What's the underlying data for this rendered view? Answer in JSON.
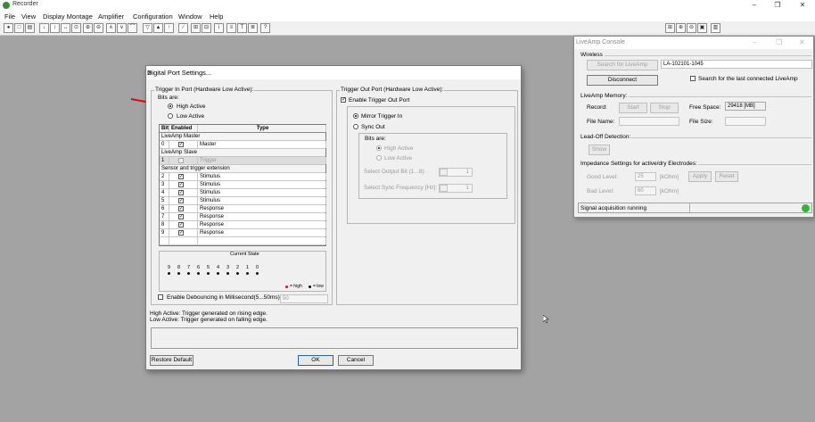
{
  "app": {
    "title": "Recorder"
  },
  "window_controls": {
    "minimize": "–",
    "maximize": "❐",
    "close": "✕"
  },
  "menu": [
    "File",
    "View",
    "Display Montage",
    "Amplifier",
    "Configuration",
    "Window",
    "Help"
  ],
  "toolbar": {
    "icons": [
      "●",
      "□",
      "▤",
      "↓",
      "↕",
      "↔",
      "⊙",
      "⊕",
      "⊖",
      "∧",
      "∨",
      "⌒",
      "▽",
      "▲",
      "↑",
      "∕",
      "⊞",
      "⊟",
      "i",
      "≡",
      "T",
      "≣",
      "?"
    ],
    "right_icons": [
      "⊞",
      "⊕",
      "⊖",
      "▣",
      "▥"
    ]
  },
  "dialog": {
    "title": "Digital Port Settings...",
    "close": "✕",
    "trigger_in": {
      "label": "Trigger In Port (Hardware Low Active):",
      "bits_are": "Bits are:",
      "high_active": "High Active",
      "low_active": "Low Active",
      "table": {
        "headers": [
          "Bit",
          "Enabled",
          "Type"
        ],
        "rows": [
          {
            "section": "LiveAmp Master"
          },
          {
            "bit": "0",
            "enabled": "✓",
            "type": "Master"
          },
          {
            "section": "LiveAmp Slave"
          },
          {
            "bit": "1",
            "enabled": "",
            "type": "Trigger"
          },
          {
            "section": "Sensor and trigger extension"
          },
          {
            "bit": "2",
            "enabled": "✓",
            "type": "Stimulus"
          },
          {
            "bit": "3",
            "enabled": "✓",
            "type": "Stimulus"
          },
          {
            "bit": "4",
            "enabled": "✓",
            "type": "Stimulus"
          },
          {
            "bit": "5",
            "enabled": "✓",
            "type": "Stimulus"
          },
          {
            "bit": "6",
            "enabled": "✓",
            "type": "Response"
          },
          {
            "bit": "7",
            "enabled": "✓",
            "type": "Response"
          },
          {
            "bit": "8",
            "enabled": "✓",
            "type": "Response"
          },
          {
            "bit": "9",
            "enabled": "✓",
            "type": "Response"
          },
          {
            "bit": "",
            "enabled": "",
            "type": ""
          }
        ]
      },
      "current_state": {
        "label": "Current State",
        "bits": [
          "9",
          "8",
          "7",
          "6",
          "5",
          "4",
          "3",
          "2",
          "1",
          "0"
        ],
        "legend_high": "= high",
        "legend_low": "= low"
      },
      "debounce_label": "Enable Debouncing in Millisecond(5...50ms):",
      "debounce_value": "50"
    },
    "trigger_out": {
      "label": "Trigger Out Port (Hardware Low Active):",
      "enable_label": "Enable Trigger Out Port",
      "mirror": "Mirror Trigger In",
      "sync_out": "Sync Out",
      "bits_are": "Bits are:",
      "high_active": "High Active",
      "low_active": "Low Active",
      "select_output_bit": "Select Output Bit (1...8):",
      "select_output_bit_value": "1",
      "select_sync_freq": "Select Sync Frequency [Hz]:",
      "select_sync_freq_value": "1"
    },
    "info_line1": "High Active: Trigger generated on rising edge.",
    "info_line2": "Low Active: Trigger generated on falling edge.",
    "restore_default": "Restore Default",
    "ok": "OK",
    "cancel": "Cancel"
  },
  "console": {
    "title": "LiveAmp Console",
    "wireless": {
      "label": "Wireless",
      "search_button": "Search for LiveAmp",
      "device_id": "LA-102101-1045",
      "disconnect": "Disconnect",
      "search_last_label": "Search for the last connected LiveAmp"
    },
    "memory": {
      "label": "LiveAmp Memory:",
      "record": "Record:",
      "start": "Start",
      "stop": "Stop",
      "free_space_label": "Free Space:",
      "free_space_value": "29418 [MB]",
      "file_name": "File Name:",
      "file_size": "File Size:"
    },
    "lead_off": {
      "label": "Lead-Off Detection:",
      "show": "Show"
    },
    "impedance": {
      "label": "Impedance Settings for active/dry Electrodes:",
      "good_level": "Good Level:",
      "good_value": "25",
      "bad_level": "Bad Level:",
      "bad_value": "60",
      "unit": "[kOhm]",
      "apply": "Apply",
      "reset": "Reset"
    },
    "status": "Signal acquisition running",
    "status_color": "#2db82d"
  },
  "colors": {
    "arrow": "#d0101a",
    "legend_high": "#d0101a"
  }
}
